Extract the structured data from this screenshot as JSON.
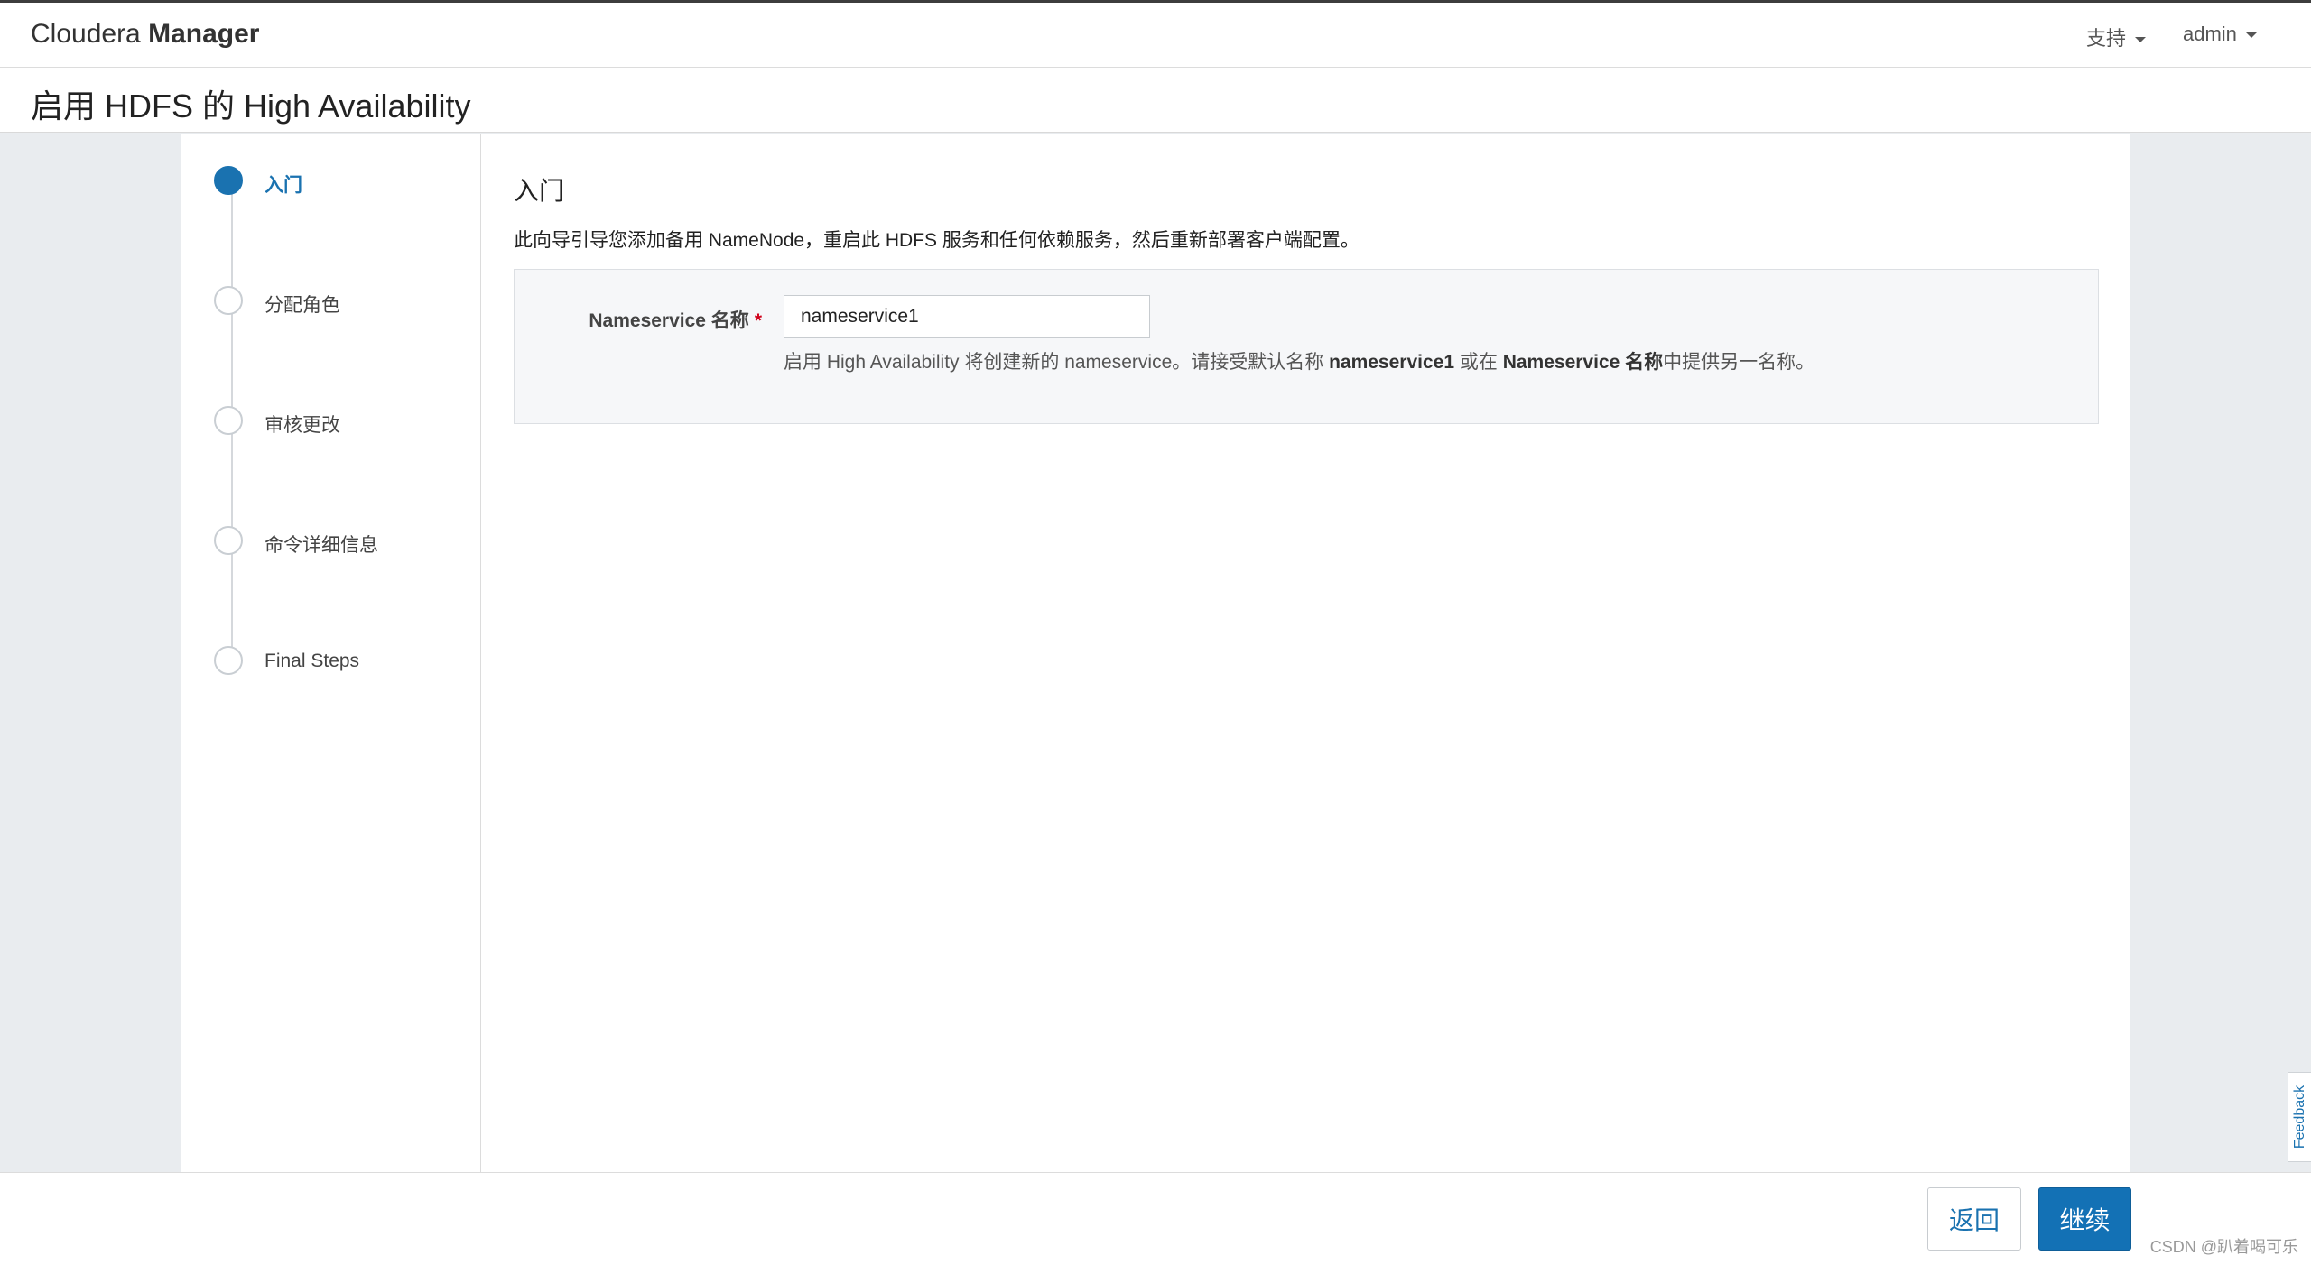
{
  "header": {
    "brand_light": "Cloudera",
    "brand_bold": "Manager",
    "support_label": "支持",
    "user_label": "admin"
  },
  "page": {
    "title": "启用 HDFS 的 High Availability"
  },
  "steps": [
    {
      "label": "入门",
      "active": true
    },
    {
      "label": "分配角色",
      "active": false
    },
    {
      "label": "审核更改",
      "active": false
    },
    {
      "label": "命令详细信息",
      "active": false
    },
    {
      "label": "Final Steps",
      "active": false
    }
  ],
  "content": {
    "section_title": "入门",
    "intro": "此向导引导您添加备用 NameNode，重启此 HDFS 服务和任何依赖服务，然后重新部署客户端配置。",
    "form": {
      "label": "Nameservice 名称",
      "required_mark": "*",
      "value": "nameservice1",
      "help_prefix": "启用 High Availability 将创建新的 nameservice。请接受默认名称 ",
      "help_bold1": "nameservice1",
      "help_mid": " 或在 ",
      "help_bold2": "Nameservice 名称",
      "help_suffix": "中提供另一名称。"
    }
  },
  "footer": {
    "back_label": "返回",
    "continue_label": "继续",
    "watermark": "CSDN @趴着喝可乐"
  },
  "feedback_label": "Feedback",
  "colors": {
    "accent": "#1a72b0",
    "primary_button": "#1371b5",
    "required": "#d0021b",
    "page_background": "#e9ecef"
  }
}
